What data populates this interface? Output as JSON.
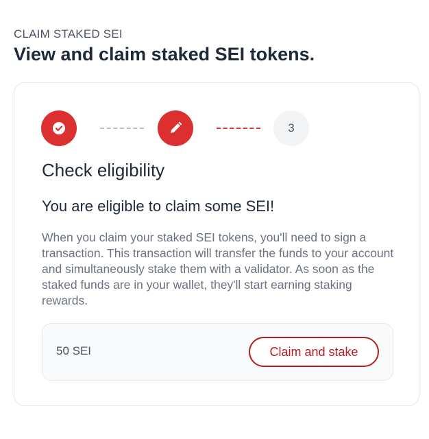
{
  "header": {
    "eyebrow": "CLAIM STAKED SEI",
    "title": "View and claim staked SEI tokens."
  },
  "stepper": {
    "steps": [
      {
        "status": "complete",
        "icon": "check-icon"
      },
      {
        "status": "active",
        "icon": "pencil-icon"
      },
      {
        "status": "pending",
        "label": "3"
      }
    ],
    "colors": {
      "accent": "#dc2f2f",
      "pending_bg": "#f3f4f6",
      "connector_inactive": "#b8bcc4"
    }
  },
  "content": {
    "section_title": "Check eligibility",
    "eligibility_message": "You are eligible to claim some SEI!",
    "description": "When you claim your staked SEI tokens, you'll need to sign a transaction. This transaction will transfer the funds to your account and simultaneously stake them with a validator. As soon as the staked funds are in your wallet, they'll start earning staking rewards."
  },
  "claim": {
    "amount": "50 SEI",
    "button_label": "Claim and stake",
    "button_color": "#b91c1c"
  }
}
